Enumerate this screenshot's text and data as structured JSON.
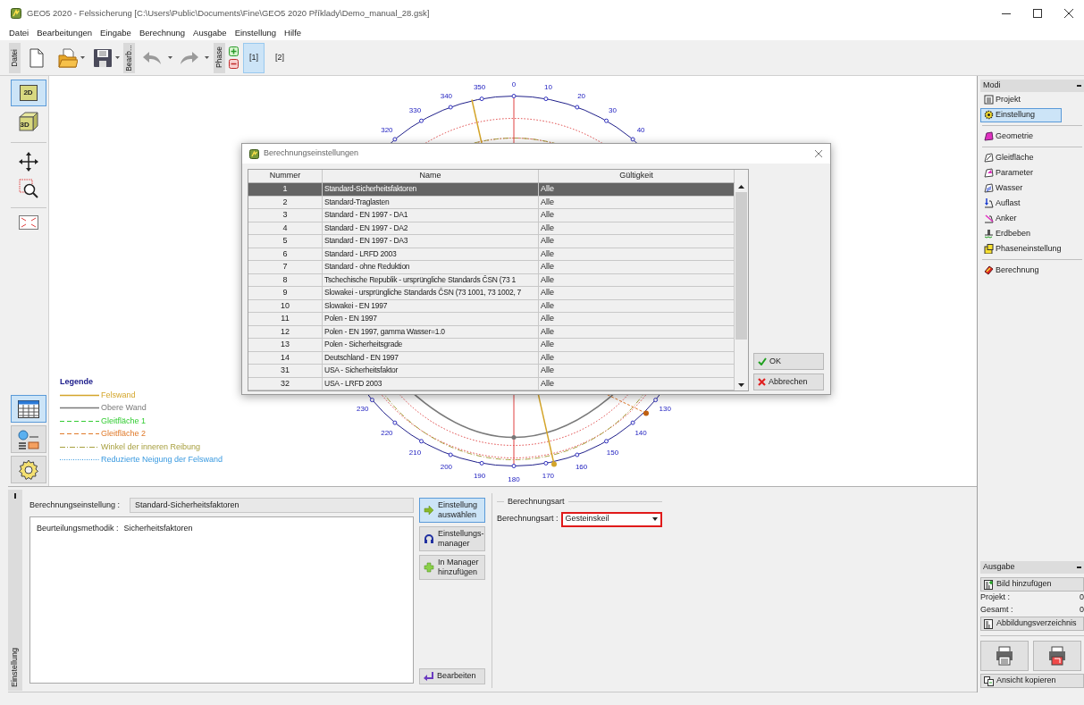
{
  "window": {
    "title": "GEO5 2020 - Felssicherung [C:\\Users\\Public\\Documents\\Fine\\GEO5 2020 Příklady\\Demo_manual_28.gsk]"
  },
  "menu": [
    "Datei",
    "Bearbeitungen",
    "Eingabe",
    "Berechnung",
    "Ausgabe",
    "Einstellung",
    "Hilfe"
  ],
  "toolbar": {
    "group_labels": [
      "Datei",
      "Bearb...",
      "Phase"
    ],
    "phases": [
      {
        "label": "[1]",
        "selected": true
      },
      {
        "label": "[2]",
        "selected": false
      }
    ]
  },
  "view_tools": [
    {
      "label": "2D",
      "selected": true
    },
    {
      "label": "3D",
      "selected": false
    }
  ],
  "panel_tools": [
    {
      "kind": "table",
      "selected": true
    },
    {
      "kind": "legend",
      "selected": false
    },
    {
      "kind": "settings",
      "selected": false
    }
  ],
  "stereonet": {
    "top_labels": [
      "320",
      "330",
      "340",
      "350",
      "0",
      "10",
      "20",
      "30",
      "40"
    ],
    "bottom_labels": [
      "130",
      "140",
      "150",
      "160",
      "170",
      "180",
      "190",
      "200",
      "210",
      "220",
      "230"
    ]
  },
  "legend": {
    "title": "Legende",
    "items": [
      {
        "label": "Felswand",
        "color": "#d4a52a",
        "kind": "solid"
      },
      {
        "label": "Obere Wand",
        "color": "#7a7a7a",
        "kind": "solid"
      },
      {
        "label": "Gleitfläche 1",
        "color": "#33cc33",
        "kind": "dashed"
      },
      {
        "label": "Gleitfläche 2",
        "color": "#e07a2a",
        "kind": "dashed"
      },
      {
        "label": "Winkel der inneren Reibung",
        "color": "#a8a040",
        "kind": "dashdot"
      },
      {
        "label": "Reduzierte Neigung der Felswand",
        "color": "#3a9ae0",
        "kind": "dotted"
      }
    ]
  },
  "dialog": {
    "title": "Berechnungseinstellungen",
    "columns": [
      "Nummer",
      "Name",
      "Gültigkeit"
    ],
    "rows": [
      {
        "number": "1",
        "name": "Standard-Sicherheitsfaktoren",
        "validity": "Alle",
        "selected": true
      },
      {
        "number": "2",
        "name": "Standard-Traglasten",
        "validity": "Alle",
        "selected": false
      },
      {
        "number": "3",
        "name": "Standard - EN 1997 - DA1",
        "validity": "Alle",
        "selected": false
      },
      {
        "number": "4",
        "name": "Standard - EN 1997 - DA2",
        "validity": "Alle",
        "selected": false
      },
      {
        "number": "5",
        "name": "Standard - EN 1997 - DA3",
        "validity": "Alle",
        "selected": false
      },
      {
        "number": "6",
        "name": "Standard - LRFD 2003",
        "validity": "Alle",
        "selected": false
      },
      {
        "number": "7",
        "name": "Standard - ohne Reduktion",
        "validity": "Alle",
        "selected": false
      },
      {
        "number": "8",
        "name": "Tschechische Republik - ursprüngliche Standards ČSN (73 1",
        "validity": "Alle",
        "selected": false
      },
      {
        "number": "9",
        "name": "Slowakei - ursprüngliche Standards ČSN (73 1001, 73 1002, 7",
        "validity": "Alle",
        "selected": false
      },
      {
        "number": "10",
        "name": "Slowakei - EN 1997",
        "validity": "Alle",
        "selected": false
      },
      {
        "number": "11",
        "name": "Polen - EN 1997",
        "validity": "Alle",
        "selected": false
      },
      {
        "number": "12",
        "name": "Polen - EN 1997, gamma Wasser=1.0",
        "validity": "Alle",
        "selected": false
      },
      {
        "number": "13",
        "name": "Polen - Sicherheitsgrade",
        "validity": "Alle",
        "selected": false
      },
      {
        "number": "14",
        "name": "Deutschland - EN 1997",
        "validity": "Alle",
        "selected": false
      },
      {
        "number": "31",
        "name": "USA - Sicherheitsfaktor",
        "validity": "Alle",
        "selected": false
      },
      {
        "number": "32",
        "name": "USA - LRFD 2003",
        "validity": "Alle",
        "selected": false
      }
    ],
    "buttons": [
      {
        "label": "OK",
        "kind": "ok"
      },
      {
        "label": "Abbrechen",
        "kind": "cancel"
      }
    ]
  },
  "modes": {
    "title": "Modi",
    "groups": [
      [
        {
          "label": "Projekt",
          "kind": "project",
          "selected": false
        },
        {
          "label": "Einstellung",
          "kind": "settings",
          "selected": true
        }
      ],
      [
        {
          "label": "Geometrie",
          "kind": "geometry",
          "selected": false
        }
      ],
      [
        {
          "label": "Gleitfläche",
          "kind": "slip",
          "selected": false
        },
        {
          "label": "Parameter",
          "kind": "parameter",
          "selected": false
        },
        {
          "label": "Wasser",
          "kind": "water",
          "selected": false
        },
        {
          "label": "Auflast",
          "kind": "surcharge",
          "selected": false
        },
        {
          "label": "Anker",
          "kind": "anchor",
          "selected": false
        },
        {
          "label": "Erdbeben",
          "kind": "earthquake",
          "selected": false
        },
        {
          "label": "Phaseneinstellung",
          "kind": "phase",
          "selected": false
        }
      ],
      [
        {
          "label": "Berechnung",
          "kind": "calculation",
          "selected": false
        }
      ]
    ]
  },
  "output": {
    "title": "Ausgabe",
    "add_button": "Bild hinzufügen",
    "counts": [
      {
        "label": "Projekt :",
        "value": "0"
      },
      {
        "label": "Gesamt :",
        "value": "0"
      }
    ],
    "list_button": "Abbildungsverzeichnis",
    "copy_button": "Ansicht kopieren"
  },
  "bottom": {
    "tab_label": "Einstellung",
    "setting_label": "Berechnungseinstellung :",
    "setting_value": "Standard-Sicherheitsfaktoren",
    "method_label": "Beurteilungsmethodik :",
    "method_value": "Sicherheitsfaktoren",
    "buttons": [
      {
        "lines": [
          "Einstellung",
          "auswählen"
        ],
        "kind": "select",
        "selected": true
      },
      {
        "lines": [
          "Einstellungs-",
          "manager"
        ],
        "kind": "manager",
        "selected": false
      },
      {
        "lines": [
          "In Manager",
          "hinzufügen"
        ],
        "kind": "add",
        "selected": false
      }
    ],
    "edit_button": "Bearbeiten",
    "group": {
      "title": "Berechnungsart",
      "label": "Berechnungsart :",
      "value": "Gesteinskeil"
    }
  }
}
